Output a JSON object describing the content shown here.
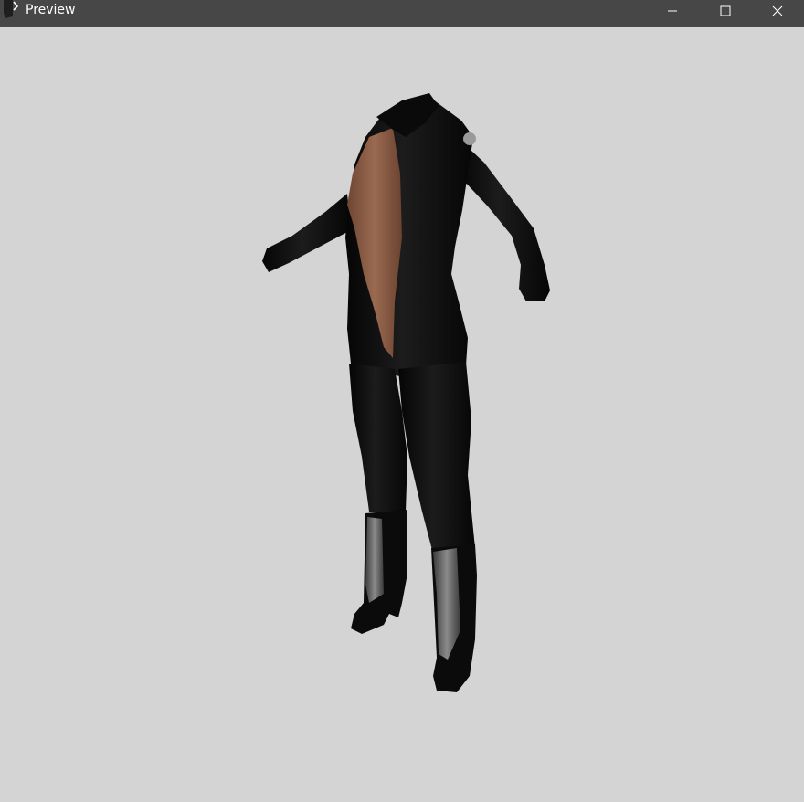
{
  "window": {
    "title": "Preview",
    "controls": {
      "minimize": "minimize-icon",
      "maximize": "maximize-icon",
      "close": "close-icon"
    }
  },
  "viewport": {
    "background": "#d4d4d4",
    "content": "3d-character-model"
  },
  "colors": {
    "titlebar": "#474747",
    "outfit": "#0d0d0d",
    "skin": "#8a5a42",
    "boot_metal": "#6a6a6a"
  }
}
